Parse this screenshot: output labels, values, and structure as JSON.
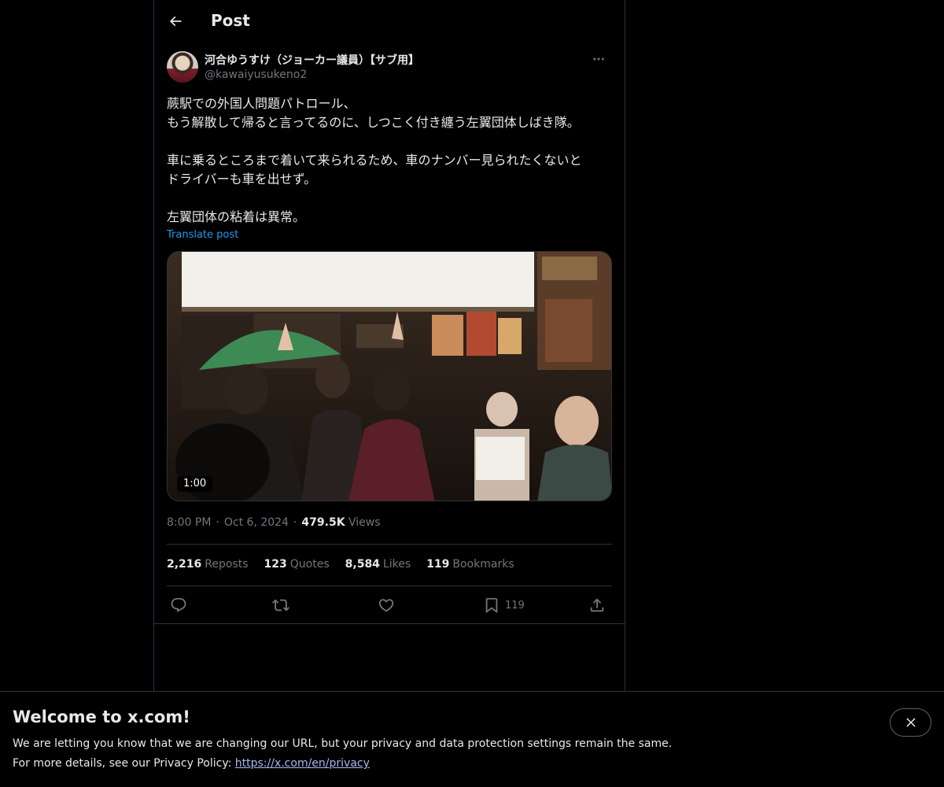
{
  "header": {
    "title": "Post"
  },
  "author": {
    "display_name": "河合ゆうすけ（ジョーカー議員）【サブ用】",
    "handle": "@kawaiyusukeno2"
  },
  "tweet": {
    "lines": [
      "蕨駅での外国人問題パトロール、",
      "もう解散して帰ると言ってるのに、しつこく付き纏う左翼団体しばき隊。",
      "",
      "車に乗るところまで着いて来られるため、車のナンバー見られたくないと",
      "ドライバーも車を出せず。",
      "",
      "左翼団体の粘着は異常。"
    ],
    "translate_label": "Translate post",
    "video_duration": "1:00"
  },
  "meta": {
    "time": "8:00 PM",
    "date": "Oct 6, 2024",
    "views_count": "479.5K",
    "views_label": "Views"
  },
  "stats": {
    "reposts": {
      "count": "2,216",
      "label": "Reposts"
    },
    "quotes": {
      "count": "123",
      "label": "Quotes"
    },
    "likes": {
      "count": "8,584",
      "label": "Likes"
    },
    "bookmarks": {
      "count": "119",
      "label": "Bookmarks"
    }
  },
  "actions": {
    "reply_icon": "reply-icon",
    "repost_icon": "repost-icon",
    "like_icon": "heart-icon",
    "bookmark_icon": "bookmark-icon",
    "bookmark_count": "119",
    "share_icon": "share-icon"
  },
  "banner": {
    "title": "Welcome to x.com!",
    "line1": "We are letting you know that we are changing our URL, but your privacy and data protection settings remain the same.",
    "line2_prefix": "For more details, see our Privacy Policy: ",
    "link": "https://x.com/en/privacy"
  },
  "colors": {
    "background": "#000000",
    "text": "#e7e9ea",
    "muted": "#71767b",
    "accent": "#1d9bf0",
    "link": "#a7b8f5",
    "border": "#2f3336"
  }
}
